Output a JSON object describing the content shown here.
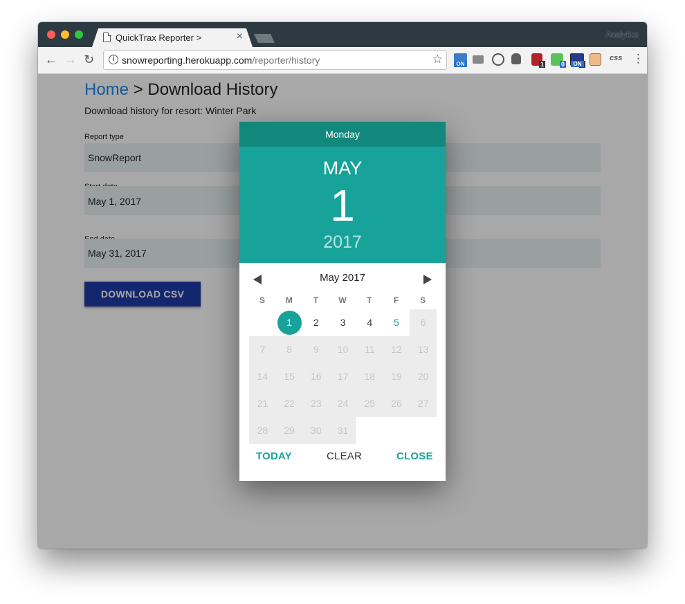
{
  "browser": {
    "tab_title": "QuickTrax Reporter >",
    "tab_close": "×",
    "profile_name": "Analytics",
    "url_host": "snowreporting.herokuapp.com",
    "url_path": "/reporter/history",
    "back_icon": "←",
    "forward_icon": "→",
    "reload_icon": "↻",
    "star_icon": "☆",
    "menu_icon": "⋮",
    "extensions": [
      {
        "name": "on-icon",
        "badge": "ON"
      },
      {
        "name": "camera-icon"
      },
      {
        "name": "1password-icon"
      },
      {
        "name": "evernote-icon"
      },
      {
        "name": "ublock-icon",
        "badge": "1"
      },
      {
        "name": "vue-devtools-icon",
        "badge": "0"
      },
      {
        "name": "dark-ext-icon",
        "badge": "0"
      },
      {
        "name": "on-icon-2",
        "badge": "ON"
      },
      {
        "name": "face-icon"
      },
      {
        "name": "css-icon",
        "label": "css"
      }
    ]
  },
  "page": {
    "breadcrumb_home": "Home",
    "breadcrumb_sep": " > ",
    "breadcrumb_current": "Download History",
    "subtitle": "Download history for resort: Winter Park",
    "report_type_label": "Report type",
    "report_type_value": "SnowReport",
    "start_date_label": "Start date",
    "start_date_value": "May  1, 2017",
    "end_date_label": "End date",
    "end_date_value": "May 31, 2017",
    "download_button": "DOWNLOAD CSV"
  },
  "picker": {
    "day_name": "Monday",
    "month": "MAY",
    "day": "1",
    "year": "2017",
    "month_year": "May  2017",
    "weekdays": [
      "S",
      "M",
      "T",
      "W",
      "T",
      "F",
      "S"
    ],
    "today_button": "TODAY",
    "clear_button": "CLEAR",
    "close_button": "CLOSE",
    "days": [
      {
        "label": "1",
        "state": "selected"
      },
      {
        "label": "2",
        "state": "enabled"
      },
      {
        "label": "3",
        "state": "enabled"
      },
      {
        "label": "4",
        "state": "enabled"
      },
      {
        "label": "5",
        "state": "today"
      },
      {
        "label": "6",
        "state": "disabled"
      },
      {
        "label": "7",
        "state": "disabled"
      },
      {
        "label": "8",
        "state": "disabled"
      },
      {
        "label": "9",
        "state": "disabled"
      },
      {
        "label": "10",
        "state": "disabled"
      },
      {
        "label": "11",
        "state": "disabled"
      },
      {
        "label": "12",
        "state": "disabled"
      },
      {
        "label": "13",
        "state": "disabled"
      },
      {
        "label": "14",
        "state": "disabled"
      },
      {
        "label": "15",
        "state": "disabled"
      },
      {
        "label": "16",
        "state": "disabled"
      },
      {
        "label": "17",
        "state": "disabled"
      },
      {
        "label": "18",
        "state": "disabled"
      },
      {
        "label": "19",
        "state": "disabled"
      },
      {
        "label": "20",
        "state": "disabled"
      },
      {
        "label": "21",
        "state": "disabled"
      },
      {
        "label": "22",
        "state": "disabled"
      },
      {
        "label": "23",
        "state": "disabled"
      },
      {
        "label": "24",
        "state": "disabled"
      },
      {
        "label": "25",
        "state": "disabled"
      },
      {
        "label": "26",
        "state": "disabled"
      },
      {
        "label": "27",
        "state": "disabled"
      },
      {
        "label": "28",
        "state": "disabled"
      },
      {
        "label": "29",
        "state": "disabled"
      },
      {
        "label": "30",
        "state": "disabled"
      },
      {
        "label": "31",
        "state": "disabled"
      }
    ],
    "first_weekday_index": 1
  },
  "colors": {
    "accent": "#18a39a",
    "accent_dark": "#12877c",
    "button": "#1f3ca8",
    "link": "#1e88e5"
  }
}
